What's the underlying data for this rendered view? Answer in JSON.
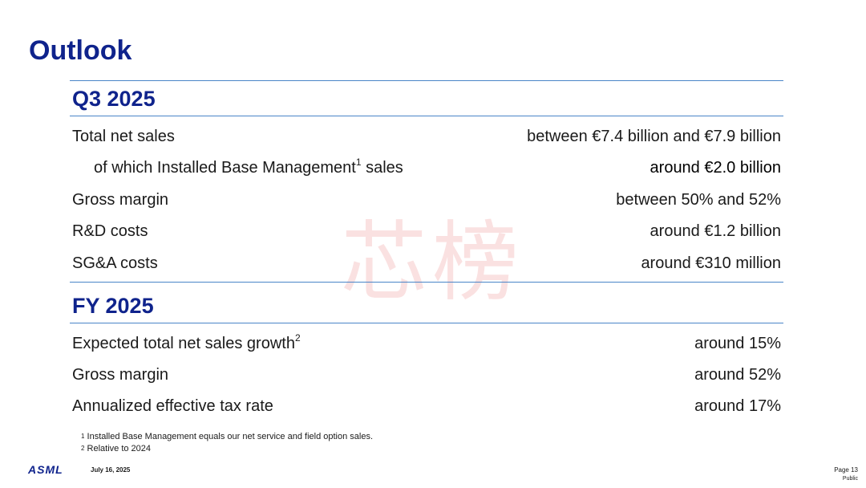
{
  "title": "Outlook",
  "watermark": "芯榜",
  "q3": {
    "heading": "Q3 2025",
    "rows": [
      {
        "label": "Total net sales",
        "sup": "",
        "label_suffix": "",
        "value": "between €7.4 billion and €7.9 billion"
      },
      {
        "label": "of which Installed Base Management",
        "sup": "1",
        "label_suffix": " sales",
        "value": "around €2.0 billion"
      },
      {
        "label": "Gross margin",
        "sup": "",
        "label_suffix": "",
        "value": "between 50% and 52%"
      },
      {
        "label": "R&D costs",
        "sup": "",
        "label_suffix": "",
        "value": "around €1.2 billion"
      },
      {
        "label": "SG&A costs",
        "sup": "",
        "label_suffix": "",
        "value": "around €310 million"
      }
    ]
  },
  "fy": {
    "heading": "FY 2025",
    "rows": [
      {
        "label": "Expected total net sales growth",
        "sup": "2",
        "value": "around 15%"
      },
      {
        "label": "Gross margin",
        "sup": "",
        "value": "around 52%"
      },
      {
        "label": "Annualized effective tax rate",
        "sup": "",
        "value": "around 17%"
      }
    ]
  },
  "footnotes": [
    {
      "mark": "1",
      "text": "Installed Base Management equals our net service and field option sales."
    },
    {
      "mark": "2",
      "text": "Relative to 2024"
    }
  ],
  "footer": {
    "logo": "ASML",
    "date": "July 16, 2025",
    "page": "Page 13",
    "classification": "Public"
  },
  "colors": {
    "heading": "#0f238c",
    "rule": "#4a86c8",
    "watermark": "#f6c9c9"
  }
}
